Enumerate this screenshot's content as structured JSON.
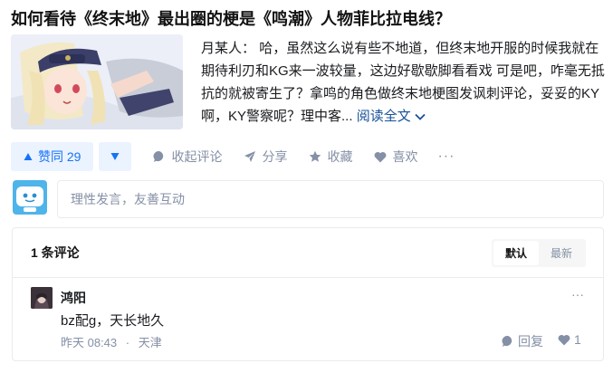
{
  "question": {
    "title": "如何看待《终末地》最出圈的梗是《鸣潮》人物菲比拉电线？"
  },
  "answer": {
    "author": "月某人",
    "separator": "：",
    "text": "哈，虽然这么说有些不地道，但终末地开服的时候我就在期待利刃和KG来一波较量，这边好歇歇脚看看戏 可是吧，咋毫无抵抗的就被寄生了？拿鸣的角色做终末地梗图发讽刺评论，妥妥的KY啊，KY警察呢？理中客...",
    "read_more": "阅读全文"
  },
  "actions": {
    "upvote_label": "赞同 29",
    "collapse_comments": "收起评论",
    "share": "分享",
    "collect": "收藏",
    "like": "喜欢",
    "more": "···"
  },
  "composer": {
    "placeholder": "理性发言，友善互动"
  },
  "comments": {
    "count_label": "1 条评论",
    "sort_options": [
      "默认",
      "最新"
    ],
    "items": [
      {
        "user": "鸿阳",
        "text": "bz配g，天长地久",
        "time": "昨天 08:43",
        "dot": "·",
        "location": "天津",
        "reply_label": "回复",
        "likes": "1",
        "more": "···"
      }
    ]
  },
  "colors": {
    "accent": "#1772f6",
    "accent_bg": "#ebf3ff",
    "muted": "#8590a6",
    "link": "#175199"
  }
}
